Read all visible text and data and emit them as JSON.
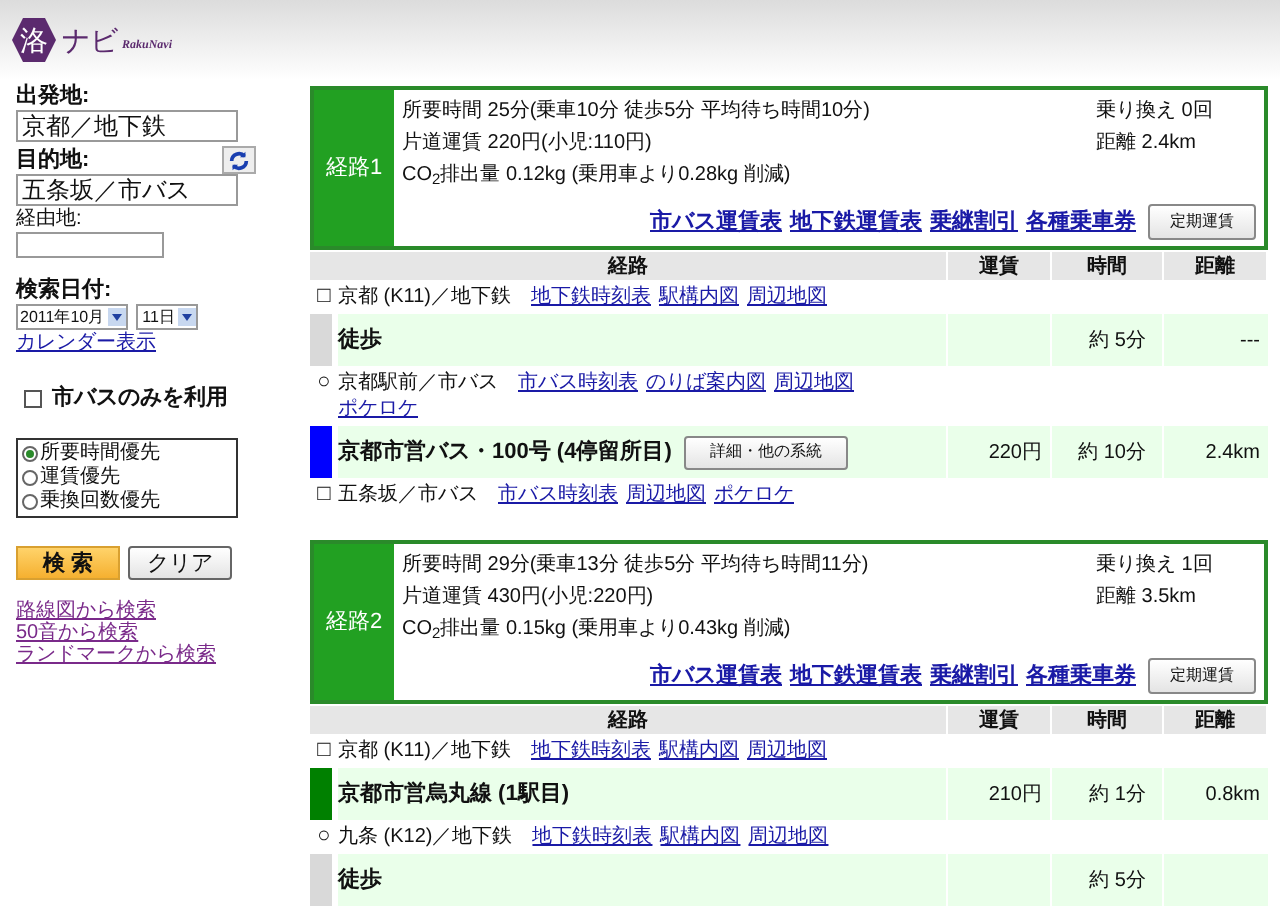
{
  "logo": {
    "mark": "洛",
    "name": "ナビ",
    "sub": "RakuNavi"
  },
  "search": {
    "from_label": "出発地:",
    "from_value": "京都／地下鉄",
    "to_label": "目的地:",
    "to_value": "五条坂／市バス",
    "via_label": "経由地:",
    "date_label": "検索日付:",
    "month": "2011年10月",
    "day": "11日",
    "calendar_link": "カレンダー表示",
    "bus_only": {
      "label": "市バスのみを利用",
      "checked": false
    },
    "priorities": [
      {
        "label": "所要時間優先",
        "selected": true
      },
      {
        "label": "運賃優先",
        "selected": false
      },
      {
        "label": "乗換回数優先",
        "selected": false
      }
    ],
    "search_button": "検 索",
    "clear_button": "クリア",
    "links": [
      "路線図から検索",
      "50音から検索",
      "ランドマークから検索"
    ]
  },
  "routes": [
    {
      "badge": "経路1",
      "time": "所要時間 25分(乗車10分 徒歩5分 平均待ち時間10分)",
      "fare": "片道運賃 220円(小児:110円)",
      "co2": "CO$_{2}$排出量 0.12kg (乗用車より0.28kg 削減)",
      "transfers": "乗り換え 0回",
      "distance": "距離 2.4km",
      "links": [
        "市バス運賃表",
        "地下鉄運賃表",
        "乗継割引",
        "各種乗車券"
      ],
      "pass_button": "定期運賃",
      "columns": [
        "経路",
        "運賃",
        "時間",
        "距離"
      ],
      "steps": [
        {
          "kind": "station",
          "marker": "□",
          "name": "京都 (K11)／地下鉄",
          "links": [
            "地下鉄時刻表",
            "駅構内図",
            "周辺地図"
          ]
        },
        {
          "kind": "segment",
          "color": "#d9d9d9",
          "name": "徒歩",
          "time": "約 5分",
          "distance": "---"
        },
        {
          "kind": "station",
          "marker": "○",
          "name": "京都駅前／市バス",
          "links": [
            "市バス時刻表",
            "のりば案内図",
            "周辺地図",
            "ポケロケ"
          ]
        },
        {
          "kind": "segment",
          "color": "#0000ff",
          "name": "京都市営バス・100号 (4停留所目)",
          "button": "詳細・他の系統",
          "fare": "220円",
          "time": "約 10分",
          "distance": "2.4km"
        },
        {
          "kind": "station",
          "marker": "□",
          "name": "五条坂／市バス",
          "links": [
            "市バス時刻表",
            "周辺地図",
            "ポケロケ"
          ]
        }
      ]
    },
    {
      "badge": "経路2",
      "time": "所要時間 29分(乗車13分 徒歩5分 平均待ち時間11分)",
      "fare": "片道運賃 430円(小児:220円)",
      "co2": "CO$_{2}$排出量 0.15kg (乗用車より0.43kg 削減)",
      "transfers": "乗り換え 1回",
      "distance": "距離 3.5km",
      "links": [
        "市バス運賃表",
        "地下鉄運賃表",
        "乗継割引",
        "各種乗車券"
      ],
      "pass_button": "定期運賃",
      "columns": [
        "経路",
        "運賃",
        "時間",
        "距離"
      ],
      "steps": [
        {
          "kind": "station",
          "marker": "□",
          "name": "京都 (K11)／地下鉄",
          "links": [
            "地下鉄時刻表",
            "駅構内図",
            "周辺地図"
          ]
        },
        {
          "kind": "segment",
          "color": "#008000",
          "name": "京都市営烏丸線 (1駅目)",
          "fare": "210円",
          "time": "約 1分",
          "distance": "0.8km"
        },
        {
          "kind": "station",
          "marker": "○",
          "name": "九条 (K12)／地下鉄",
          "links": [
            "地下鉄時刻表",
            "駅構内図",
            "周辺地図"
          ]
        },
        {
          "kind": "segment",
          "color": "#d9d9d9",
          "name": "徒歩",
          "time": "約 5分"
        }
      ]
    }
  ]
}
